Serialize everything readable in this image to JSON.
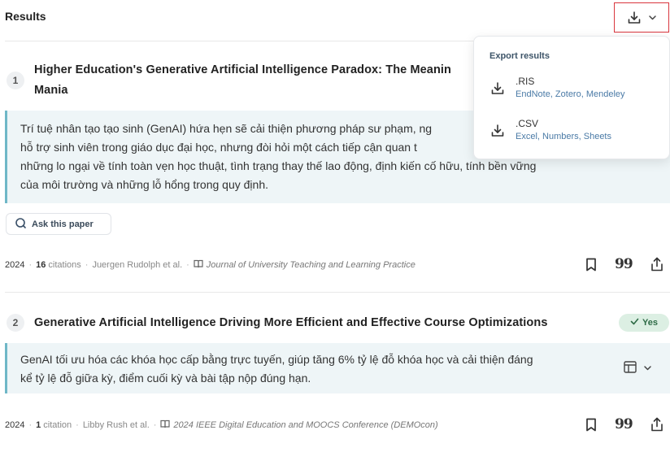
{
  "header": {
    "title": "Results"
  },
  "papers": [
    {
      "rank": "1",
      "title_line1": "Higher Education's Generative Artificial Intelligence Paradox: The Meanin",
      "title_line2": "Mania",
      "summary_lines": [
        "Trí tuệ nhân tạo tạo sinh (GenAI) hứa hẹn sẽ cải thiện phương pháp sư phạm, ng",
        "hỗ trợ sinh viên trong giáo dục đại học, nhưng đòi hỏi một cách tiếp cận quan t",
        "những lo ngại về tính toàn vẹn học thuật, tình trạng thay thế lao động, định kiến cố hữu, tính bền vững",
        "của môi trường và những lỗ hổng trong quy định."
      ],
      "ask_label": "Ask this paper",
      "year": "2024",
      "citations_count": "16",
      "citations_label": "citations",
      "authors": "Juergen Rudolph et al.",
      "journal": "Journal of University Teaching and Learning Practice"
    },
    {
      "rank": "2",
      "title_line1": "Generative Artificial Intelligence Driving More Efficient and Effective Course Optimizations",
      "badge": "Yes",
      "summary_lines": [
        "GenAI tối ưu hóa các khóa học cấp bằng trực tuyến, giúp tăng 6% tỷ lệ đỗ khóa học và cải thiện đáng",
        "kể tỷ lệ đỗ giữa kỳ, điểm cuối kỳ và bài tập nộp đúng hạn."
      ],
      "year": "2024",
      "citations_count": "1",
      "citations_label": "citation",
      "authors": "Libby Rush et al.",
      "journal": "2024 IEEE Digital Education and MOOCS Conference (DEMOcon)"
    }
  ],
  "export_menu": {
    "title": "Export results",
    "items": [
      {
        "name": ".RIS",
        "sub": "EndNote, Zotero, Mendeley"
      },
      {
        "name": ".CSV",
        "sub": "Excel, Numbers, Sheets"
      }
    ]
  },
  "colors": {
    "accent_red": "#d9363e",
    "summary_bg": "#eef5f7",
    "summary_border": "#6fb7c7",
    "yes_bg": "#dcefe3"
  },
  "icons": [
    "download-icon",
    "chevron-down-icon",
    "chat-icon",
    "book-icon",
    "bookmark-icon",
    "quote-icon",
    "share-icon",
    "check-icon",
    "table-icon"
  ]
}
